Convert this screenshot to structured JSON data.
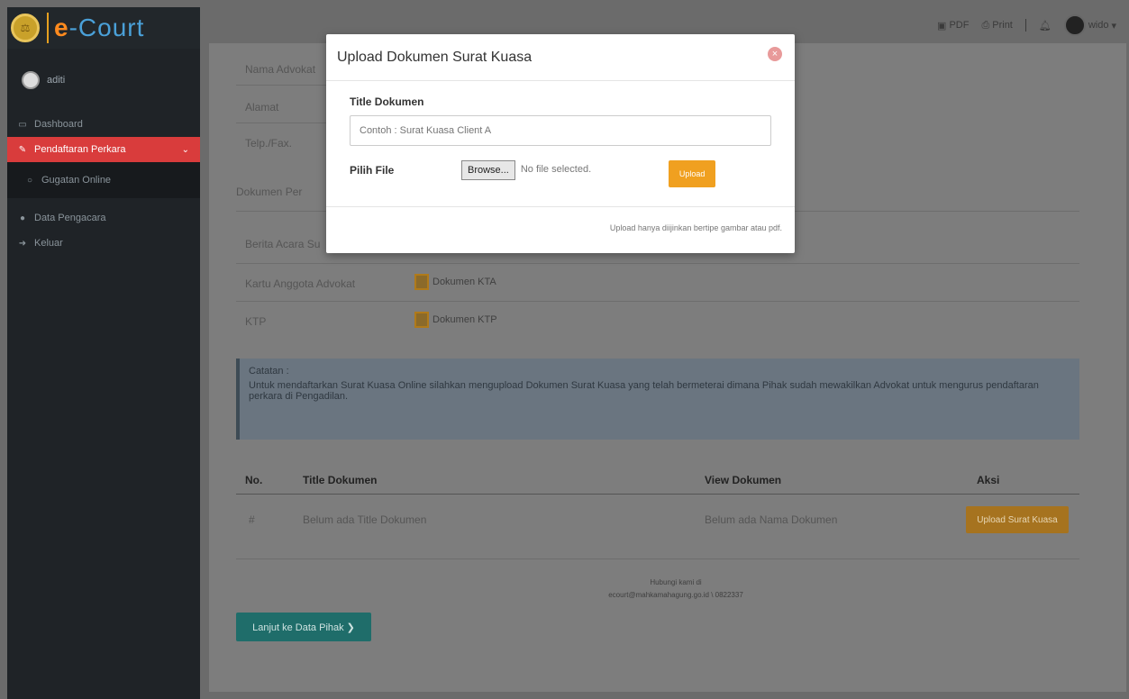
{
  "brand": {
    "name_e": "e",
    "name_court": "-Court",
    "logo_glyph": "⚖"
  },
  "sidebar": {
    "user_name": "aditi",
    "items": [
      {
        "label": "Dashboard",
        "icon": "monitor-icon"
      },
      {
        "label": "Pendaftaran Perkara",
        "icon": "edit-icon"
      },
      {
        "label": "Gugatan Online",
        "icon": "circle-icon"
      },
      {
        "label": "Data Pengacara",
        "icon": "user-icon"
      },
      {
        "label": "Keluar",
        "icon": "logout-icon"
      }
    ]
  },
  "topbar": {
    "pdf_label": "PDF",
    "print_label": "Print",
    "user_label": "wido"
  },
  "content": {
    "nama_advokat": "Nama Advokat",
    "alamat": "Alamat",
    "telp_fax": "Telp./Fax.",
    "section_title": "Dokumen Per",
    "berita_acara": "Berita Acara Su",
    "kartu_anggota": "Kartu Anggota Advokat",
    "ktp": "KTP",
    "dokumen_kta": "Dokumen KTA",
    "dokumen_ktp": "Dokumen KTP",
    "note_title": "Catatan :",
    "note_text": "Untuk mendaftarkan Surat Kuasa Online silahkan mengupload Dokumen Surat Kuasa yang telah bermeterai dimana Pihak sudah mewakilkan Advokat untuk mengurus pendaftaran perkara di Pengadilan.",
    "table": {
      "headers": [
        "No.",
        "Title Dokumen",
        "View Dokumen",
        "Aksi"
      ],
      "row": {
        "no": "#",
        "title": "Belum ada Title Dokumen",
        "view": "Belum ada Nama Dokumen",
        "action": "Upload Surat Kuasa"
      }
    },
    "footer_line1": "Hubungi kami di",
    "footer_line2": "ecourt@mahkamahagung.go.id  \\ 0822337",
    "next_button": "Lanjut ke Data Pihak ❯"
  },
  "modal": {
    "title": "Upload Dokumen Surat Kuasa",
    "close_glyph": "×",
    "title_label": "Title Dokumen",
    "title_placeholder": "Contoh : Surat Kuasa Client A",
    "file_label": "Pilih File",
    "browse_label": "Browse...",
    "no_file_text": "No file selected.",
    "upload_label": "Upload",
    "footer_note": "Upload hanya diijinkan bertipe gambar atau pdf."
  }
}
